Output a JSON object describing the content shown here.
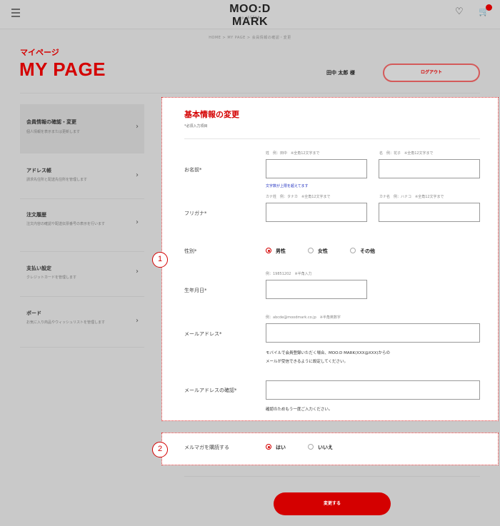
{
  "header": {
    "logo": "MOO:D MARK",
    "logo_sub": "by ISETAN",
    "breadcrumb": "HOME  >  MY PAGE  >  会員情報の確認・変更"
  },
  "page": {
    "title_jp": "マイページ",
    "title": "MY PAGE",
    "user_name": "田中 太郎 様",
    "logout_label": "ログアウト"
  },
  "sidebar": {
    "items": [
      {
        "title": "会員情報の確認・変更",
        "desc": "個人情報を表示または更新します",
        "active": true
      },
      {
        "title": "アドレス帳",
        "desc": "請求先住所と配送先住所を管理します",
        "active": false
      },
      {
        "title": "注文履歴",
        "desc": "注文内容の確認や配送伝票番号の表示を行います",
        "active": false
      },
      {
        "title": "支払い設定",
        "desc": "クレジットカードを管理します",
        "active": false
      },
      {
        "title": "ボード",
        "desc": "お気に入り商品やウィッシュリストを管理します",
        "active": false
      }
    ]
  },
  "form": {
    "title": "基本情報の変更",
    "required_note": "*必須入力項目",
    "name": {
      "label": "お名前*",
      "last_hint": "姓　例：田中　※全角12文字まで",
      "first_hint": "名　例：花子　※全角12文字まで",
      "warning": "文字数が上限を超えてます"
    },
    "furigana": {
      "label": "フリガナ*",
      "last_hint": "カナ姓　例：タナカ　※全角12文字まで",
      "first_hint": "カナ名　例：ハナコ　※全角12文字まで"
    },
    "gender": {
      "label": "性別*",
      "options": [
        "男性",
        "女性",
        "その他"
      ],
      "selected": "男性"
    },
    "birthday": {
      "label": "生年月日*",
      "hint": "例：19851202　※半角入力"
    },
    "email": {
      "label": "メールアドレス*",
      "hint": "例：abcde@moodmark.co.jp　※半角英数字",
      "note1": "モバイルで会員登録いただく場合、MOO:D MARK(XXX@XXX)からの",
      "note2": "メールが受信できるように設定してください。"
    },
    "email_confirm": {
      "label": "メールアドレスの確認*",
      "note": "確認のためもう一度ご入力ください。"
    },
    "newsletter": {
      "label": "メルマガを購読する",
      "options": [
        "はい",
        "いいえ"
      ],
      "selected": "はい"
    },
    "submit_label": "変更する"
  },
  "annotations": [
    "1",
    "2"
  ],
  "colors": {
    "accent": "#d40000",
    "overlay": "#c9c9c9"
  }
}
